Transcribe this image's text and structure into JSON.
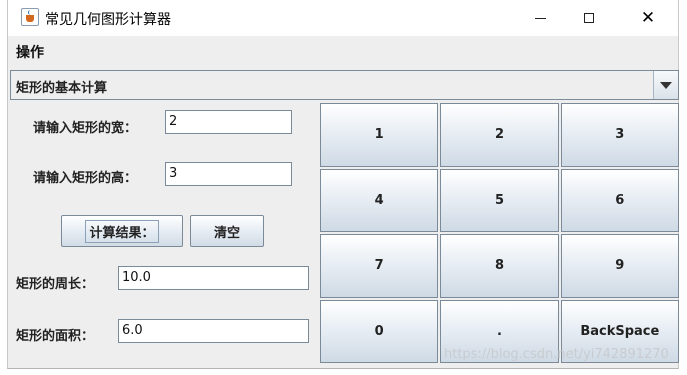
{
  "window": {
    "title": "常见几何图形计算器"
  },
  "menubar": {
    "items": [
      {
        "label": "操作"
      }
    ]
  },
  "shape_select": {
    "selected": "矩形的基本计算"
  },
  "form": {
    "width_label": "请输入矩形的宽：",
    "width_value": "2",
    "height_label": "请输入矩形的高：",
    "height_value": "3",
    "calculate_button": "计算结果：",
    "clear_button": "清空",
    "perimeter_label": "矩形的周长：",
    "perimeter_value": "10.0",
    "area_label": "矩形的面积：",
    "area_value": "6.0"
  },
  "keypad": {
    "keys": [
      "1",
      "2",
      "3",
      "4",
      "5",
      "6",
      "7",
      "8",
      "9",
      "0",
      ".",
      "BackSpace"
    ]
  },
  "watermark": "https://blog.csdn.net/yi742891270"
}
